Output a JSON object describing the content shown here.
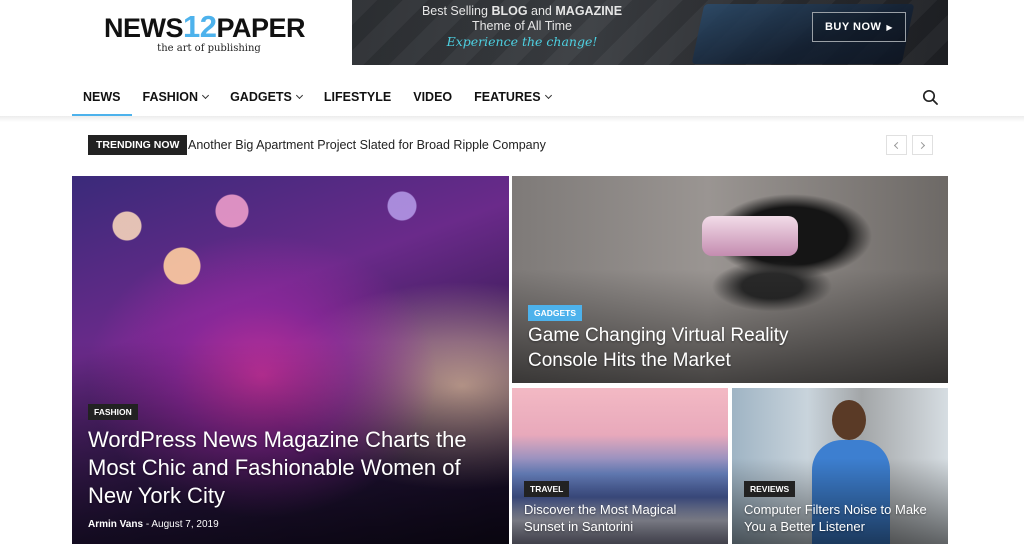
{
  "logo": {
    "prefix": "NEWS",
    "number": "12",
    "suffix": "PAPER",
    "tagline": "the art of publishing"
  },
  "banner": {
    "line1_a": "Best Selling",
    "line1_b": "BLOG",
    "line1_c": "and",
    "line1_d": "MAGAZINE",
    "line2": "Theme of All Time",
    "line3": "Experience the change!",
    "cta": "BUY NOW"
  },
  "nav": {
    "items": [
      {
        "label": "NEWS"
      },
      {
        "label": "FASHION"
      },
      {
        "label": "GADGETS"
      },
      {
        "label": "LIFESTYLE"
      },
      {
        "label": "VIDEO"
      },
      {
        "label": "FEATURES"
      }
    ]
  },
  "trending": {
    "label": "TRENDING NOW",
    "headline": "Another Big Apartment Project Slated for Broad Ripple Company"
  },
  "articles": [
    {
      "category": "FASHION",
      "title": "WordPress News Magazine Charts the Most Chic and Fashionable Women of New York City",
      "author": "Armin Vans",
      "date": "August 7, 2019"
    },
    {
      "category": "GADGETS",
      "title": "Game Changing Virtual Reality Console Hits the Market"
    },
    {
      "category": "TRAVEL",
      "title": "Discover the Most Magical Sunset in Santorini"
    },
    {
      "category": "REVIEWS",
      "title": "Computer Filters Noise to Make You a Better Listener"
    }
  ],
  "colors": {
    "accent": "#4db2ec",
    "dark": "#222222"
  }
}
